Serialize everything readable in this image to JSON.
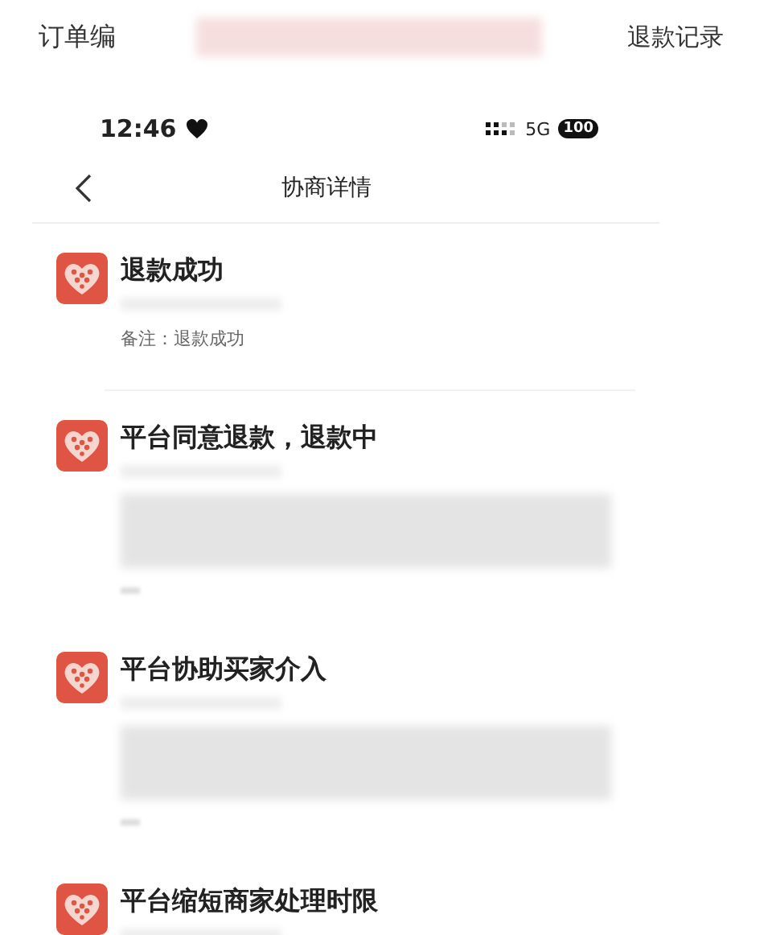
{
  "header": {
    "order_label": "订单编",
    "refund_records_link": "退款记录"
  },
  "status_bar": {
    "time": "12:46",
    "network": "5G",
    "battery": "100"
  },
  "nav": {
    "title": "协商详情"
  },
  "entries": [
    {
      "title": "退款成功",
      "remark": "备注：退款成功"
    },
    {
      "title": "平台同意退款，退款中"
    },
    {
      "title": "平台协助买家介入"
    },
    {
      "title": "平台缩短商家处理时限"
    }
  ]
}
